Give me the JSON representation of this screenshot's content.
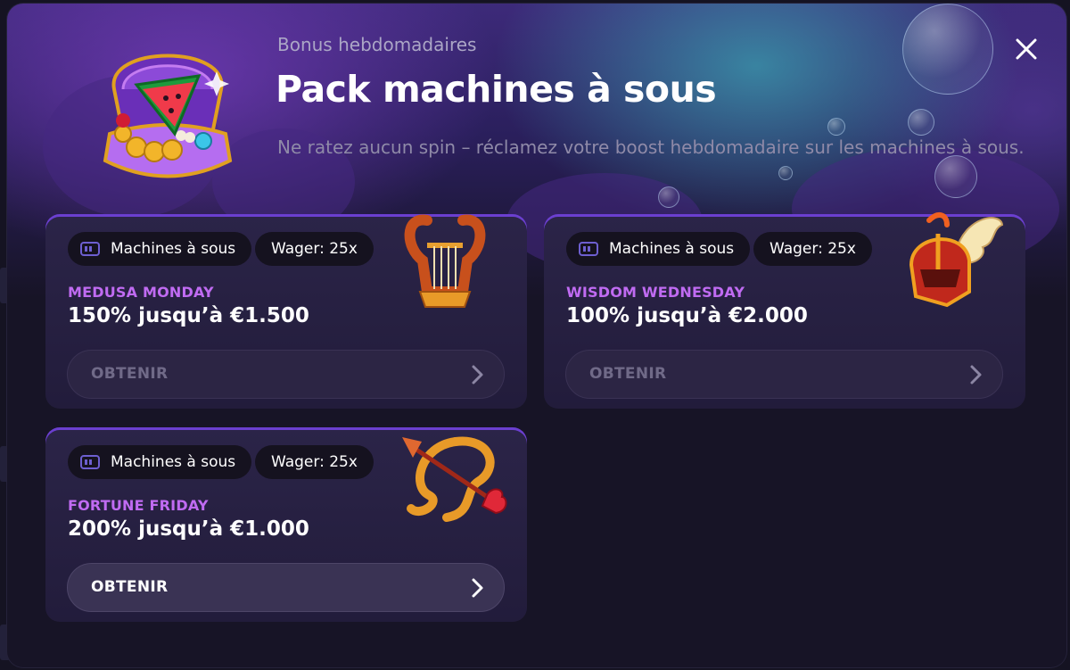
{
  "modal": {
    "subtitle": "Bonus hebdomadaires",
    "title": "Pack machines à sous",
    "description": "Ne ratez aucun spin – réclamez votre boost hebdomadaire sur les machines à sous.",
    "close_icon": "close-icon",
    "hero_icon": "treasure-shell-watermelon-icon"
  },
  "cards": [
    {
      "category": "Machines à sous",
      "wager": "Wager: 25x",
      "name": "MEDUSA MONDAY",
      "offer": "150% jusqu’à €1.500",
      "button": "OBTENIR",
      "button_enabled": false,
      "icon": "lyre-icon"
    },
    {
      "category": "Machines à sous",
      "wager": "Wager: 25x",
      "name": "WISDOM WEDNESDAY",
      "offer": "100% jusqu’à €2.000",
      "button": "OBTENIR",
      "button_enabled": false,
      "icon": "winged-helmet-icon"
    },
    {
      "category": "Machines à sous",
      "wager": "Wager: 25x",
      "name": "FORTUNE FRIDAY",
      "offer": "200% jusqu’à €1.000",
      "button": "OBTENIR",
      "button_enabled": true,
      "icon": "bow-and-arrow-icon"
    }
  ],
  "colors": {
    "accent_purple": "#c06bf2",
    "card_border": "#6b3fd0",
    "background": "#171426"
  }
}
